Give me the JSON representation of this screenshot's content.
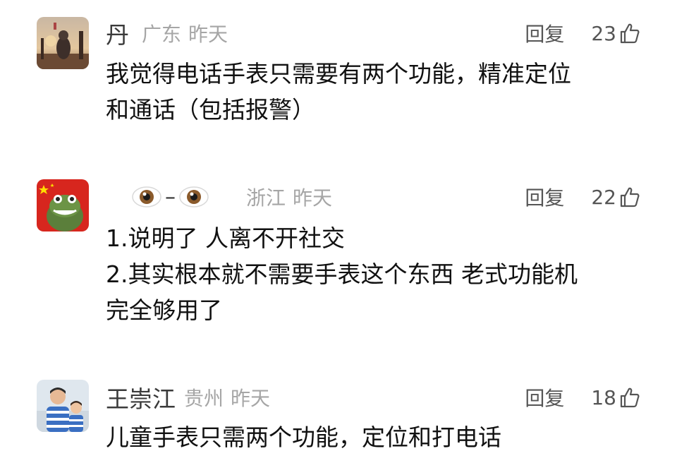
{
  "comments": [
    {
      "username": "丹",
      "location": "广东",
      "time": "昨天",
      "reply_label": "回复",
      "likes": "23",
      "lines": [
        "我觉得电话手表只需要有两个功能，精准定位",
        "和通话（包括报警）"
      ]
    },
    {
      "username": "–",
      "location": "浙江",
      "time": "昨天",
      "reply_label": "回复",
      "likes": "22",
      "lines": [
        "1.说明了 人离不开社交",
        "2.其实根本就不需要手表这个东西 老式功能机",
        "完全够用了"
      ]
    },
    {
      "username": "王崇江",
      "location": "贵州",
      "time": "昨天",
      "reply_label": "回复",
      "likes": "18",
      "lines": [
        "儿童手表只需两个功能，定位和打电话"
      ]
    }
  ],
  "icons": {
    "like": "thumbs-up-icon",
    "eye": "eyes-emoji-icon"
  },
  "colors": {
    "meta_gray": "#a6a6a6",
    "text": "#111111",
    "action": "#555555"
  }
}
